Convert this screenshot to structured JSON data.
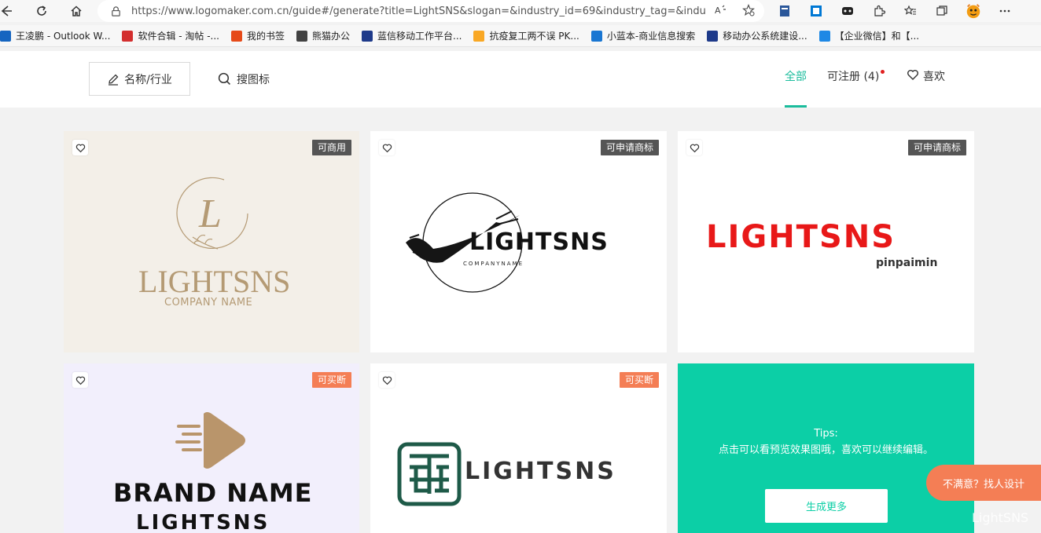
{
  "browser": {
    "url": "https://www.logomaker.com.cn/guide#/generate?title=LightSNS&slogan=&industry_id=69&industry_tag=&indust...",
    "icons": [
      "back-icon",
      "refresh-icon",
      "home-icon",
      "lock-icon",
      "read-aloud-icon",
      "add-favorite-icon",
      "favorites-icon",
      "collections-icon",
      "more-icon"
    ]
  },
  "bookmarks": [
    {
      "label": "王凌鹏 - Outlook W...",
      "color": "#1565c0"
    },
    {
      "label": "软件合辑 - 淘帖 -...",
      "color": "#d32f2f"
    },
    {
      "label": "我的书签",
      "color": "#e64a19"
    },
    {
      "label": "熊猫办公",
      "color": "#424242"
    },
    {
      "label": "蓝信移动工作平台...",
      "color": "#1e3a8a"
    },
    {
      "label": "抗疫复工两不误 PK...",
      "color": "#f9a825"
    },
    {
      "label": "小蓝本-商业信息搜索",
      "color": "#1976d2"
    },
    {
      "label": "移动办公系统建设...",
      "color": "#1e3a8a"
    },
    {
      "label": "【企业微信】和【...",
      "color": "#1e88e5"
    }
  ],
  "header": {
    "name_industry": "名称/行业",
    "search_logo": "搜图标",
    "tabs": {
      "all": "全部",
      "registrable": "可注册 (4)",
      "favorites": "喜欢"
    }
  },
  "cards": [
    {
      "badge": "可商用",
      "name": "LIGHTSNS",
      "sub": "COMPANY NAME",
      "monogram": "L"
    },
    {
      "badge": "可申请商标",
      "name": "LIGHTSNS",
      "sub": "COMPANYNAME"
    },
    {
      "badge": "可申请商标",
      "name": "LIGHTSNS",
      "sub": "pinpaimin"
    },
    {
      "badge": "可买断",
      "name": "BRAND NAME",
      "sub": "LIGHTSNS"
    },
    {
      "badge": "可买断",
      "name": "LIGHTSNS"
    }
  ],
  "tips": {
    "title": "Tips:",
    "body": "点击可以看预览效果图哦，喜欢可以继续编辑。",
    "button": "生成更多"
  },
  "float_button": "不满意？找人设计",
  "corner_brand": "LightSNS",
  "colors": {
    "accent": "#1abc9c",
    "tips_bg": "#0ccfa6",
    "orange": "#f47e55",
    "red_logo": "#e81818",
    "gold_logo": "#b49a74"
  }
}
